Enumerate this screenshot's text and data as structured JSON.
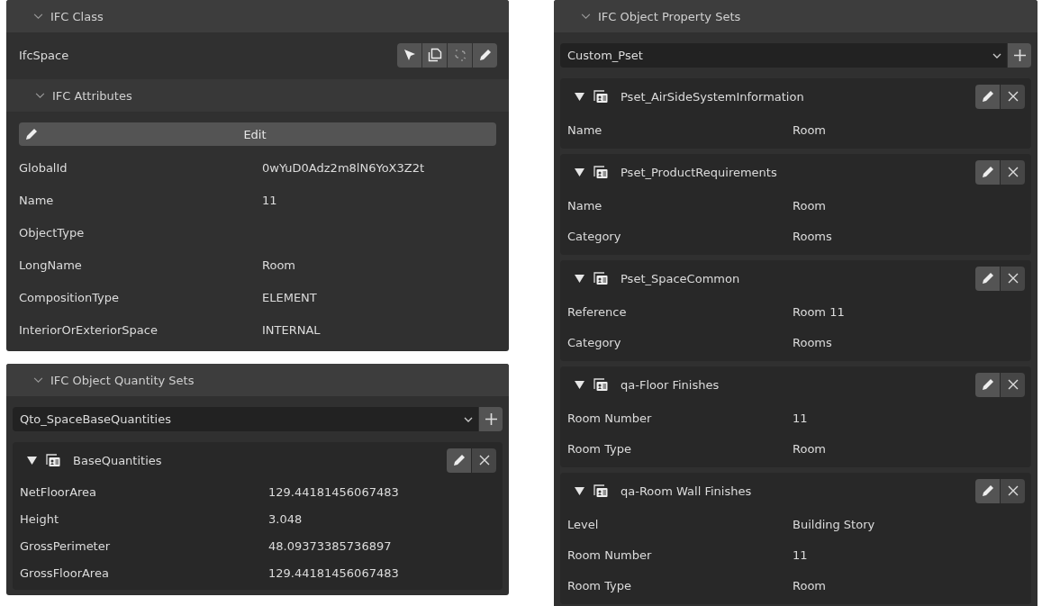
{
  "ifc_class": {
    "title": "IFC Class",
    "expanded": true,
    "class_name": "IfcSpace",
    "attributes": {
      "title": "IFC Attributes",
      "expanded": true,
      "edit_button": "Edit",
      "rows": [
        {
          "name": "GlobalId",
          "value": "0wYuD0Adz2m8lN6YoX3Z2t"
        },
        {
          "name": "Name",
          "value": "11"
        },
        {
          "name": "ObjectType"
        },
        {
          "name": "LongName",
          "value": "Room"
        },
        {
          "name": "CompositionType",
          "value": "ELEMENT"
        },
        {
          "name": "InteriorOrExteriorSpace",
          "value": "INTERNAL"
        }
      ]
    }
  },
  "quantity_sets": {
    "title": "IFC Object Quantity Sets",
    "expanded": true,
    "selector": "Qto_SpaceBaseQuantities",
    "sets": [
      {
        "name": "BaseQuantities",
        "expanded": true,
        "rows": [
          {
            "name": "NetFloorArea",
            "value": "129.44181456067483"
          },
          {
            "name": "Height",
            "value": "3.048"
          },
          {
            "name": "GrossPerimeter",
            "value": "48.09373385736897"
          },
          {
            "name": "GrossFloorArea",
            "value": "129.44181456067483"
          }
        ]
      }
    ]
  },
  "property_sets": {
    "title": "IFC Object Property Sets",
    "expanded": true,
    "selector": "Custom_Pset",
    "sets": [
      {
        "name": "Pset_AirSideSystemInformation",
        "expanded": true,
        "rows": [
          {
            "name": "Name",
            "value": "Room"
          }
        ]
      },
      {
        "name": "Pset_ProductRequirements",
        "expanded": true,
        "rows": [
          {
            "name": "Name",
            "value": "Room"
          },
          {
            "name": "Category",
            "value": "Rooms"
          }
        ]
      },
      {
        "name": "Pset_SpaceCommon",
        "expanded": true,
        "rows": [
          {
            "name": "Reference",
            "value": "Room 11"
          },
          {
            "name": "Category",
            "value": "Rooms"
          }
        ]
      },
      {
        "name": "qa-Floor Finishes",
        "expanded": true,
        "rows": [
          {
            "name": "Room Number",
            "value": "11"
          },
          {
            "name": "Room Type",
            "value": "Room"
          }
        ]
      },
      {
        "name": "qa-Room Wall Finishes",
        "expanded": true,
        "rows": [
          {
            "name": "Level",
            "value": "Building Story"
          },
          {
            "name": "Room Number",
            "value": "11"
          },
          {
            "name": "Room Type",
            "value": "Room"
          }
        ]
      }
    ]
  }
}
